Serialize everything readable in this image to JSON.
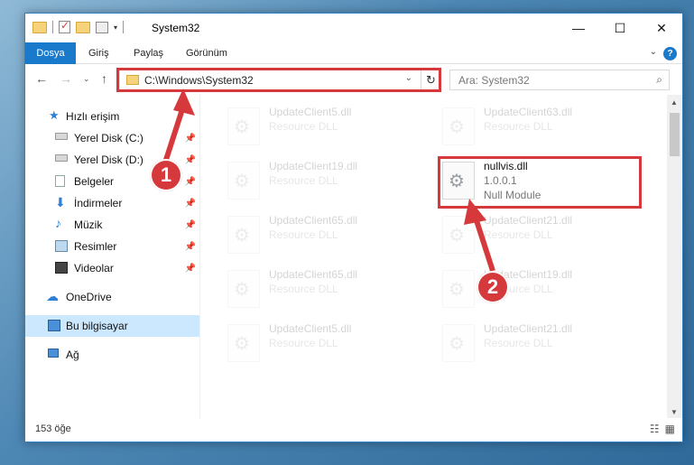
{
  "window": {
    "title": "System32",
    "controls": {
      "minimize": "—",
      "maximize": "☐",
      "close": "✕"
    }
  },
  "ribbon": {
    "tabs": [
      "Dosya",
      "Giriş",
      "Paylaş",
      "Görünüm"
    ],
    "help": "?"
  },
  "address": {
    "path": "C:\\Windows\\System32",
    "search_placeholder": "Ara: System32"
  },
  "nav": {
    "items": [
      {
        "label": "Hızlı erişim",
        "icon": "star-icon",
        "pinned": false
      },
      {
        "label": "Yerel Disk (C:)",
        "icon": "drive-icon",
        "pinned": true
      },
      {
        "label": "Yerel Disk (D:)",
        "icon": "drive-icon",
        "pinned": true
      },
      {
        "label": "Belgeler",
        "icon": "documents-icon",
        "pinned": true
      },
      {
        "label": "İndirmeler",
        "icon": "download-icon",
        "pinned": true
      },
      {
        "label": "Müzik",
        "icon": "music-icon",
        "pinned": true
      },
      {
        "label": "Resimler",
        "icon": "pictures-icon",
        "pinned": true
      },
      {
        "label": "Videolar",
        "icon": "video-icon",
        "pinned": true
      },
      {
        "label": "OneDrive",
        "icon": "cloud-icon",
        "pinned": false
      },
      {
        "label": "Bu bilgisayar",
        "icon": "computer-icon",
        "pinned": false,
        "selected": true
      },
      {
        "label": "Ağ",
        "icon": "network-icon",
        "pinned": false
      }
    ]
  },
  "files": [
    {
      "name": "UpdateClient5.dll",
      "desc": "Resource DLL",
      "faded": true
    },
    {
      "name": "UpdateClient63.dll",
      "desc": "Resource DLL",
      "faded": true
    },
    {
      "name": "UpdateClient19.dll",
      "desc": "Resource DLL",
      "faded": true
    },
    {
      "name": "nullvis.dll",
      "desc": "1.0.0.1",
      "module": "Null Module",
      "faded": false
    },
    {
      "name": "UpdateClient65.dll",
      "desc": "Resource DLL",
      "faded": true
    },
    {
      "name": "UpdateClient21.dll",
      "desc": "Resource DLL",
      "faded": true
    },
    {
      "name": "UpdateClient65.dll",
      "desc": "Resource DLL",
      "faded": true
    },
    {
      "name": "UpdateClient19.dll",
      "desc": "Resource DLL",
      "faded": true
    },
    {
      "name": "UpdateClient5.dll",
      "desc": "Resource DLL",
      "faded": true
    },
    {
      "name": "UpdateClient21.dll",
      "desc": "Resource DLL",
      "faded": true
    }
  ],
  "status": {
    "count": "153 öğe"
  },
  "callouts": {
    "one": "1",
    "two": "2"
  },
  "colors": {
    "accent": "#1979ca",
    "highlight": "#d6393c",
    "selected": "#cce8ff"
  }
}
